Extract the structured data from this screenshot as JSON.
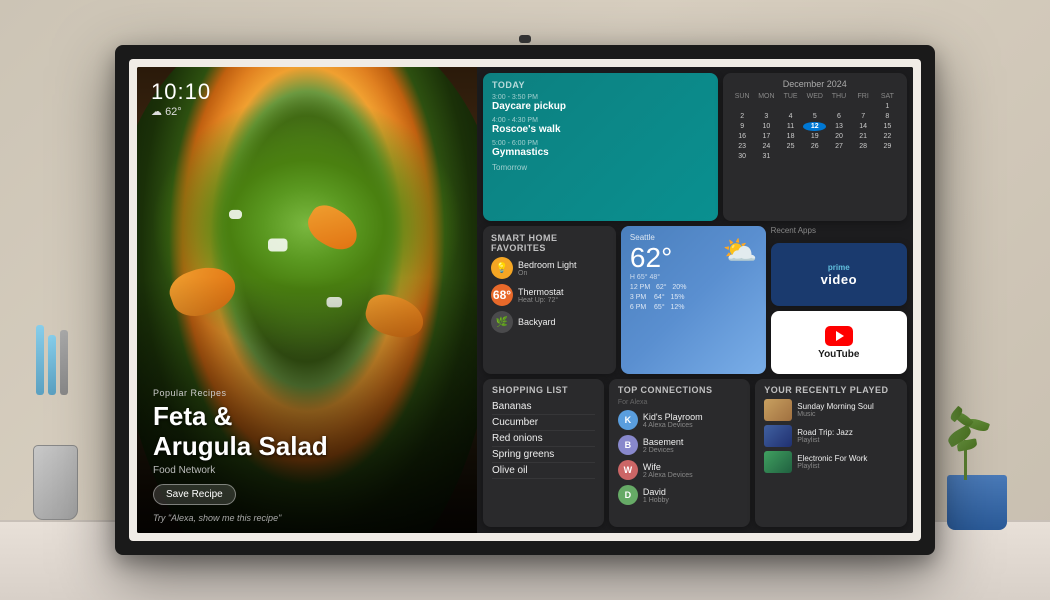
{
  "device": {
    "camera_label": "camera"
  },
  "recipe": {
    "label": "Popular Recipes",
    "title_line1": "Feta &",
    "title_line2": "Arugula Salad",
    "source": "Food Network",
    "save_button": "Save Recipe",
    "alexa_hint": "Try \"Alexa, show me this recipe\""
  },
  "clock": {
    "time": "10:10",
    "temp": "62°"
  },
  "today": {
    "section_title": "Today",
    "events": [
      {
        "time": "3:00 - 3:50 PM",
        "name": "Daycare pickup"
      },
      {
        "time": "4:00 - 4:30 PM",
        "name": "Roscoe's walk"
      },
      {
        "time": "5:00 - 6:00 PM",
        "name": "Gymnastics"
      }
    ],
    "tomorrow_label": "Tomorrow"
  },
  "calendar": {
    "month": "December 2024",
    "day_names": [
      "SUN",
      "MON",
      "TUE",
      "WED",
      "THU",
      "FRI",
      "SAT"
    ],
    "days": [
      {
        "d": "",
        "empty": true
      },
      {
        "d": "",
        "empty": true
      },
      {
        "d": "",
        "empty": true
      },
      {
        "d": "",
        "empty": true
      },
      {
        "d": "",
        "empty": true
      },
      {
        "d": "",
        "empty": true
      },
      {
        "d": "1"
      },
      {
        "d": "2"
      },
      {
        "d": "3"
      },
      {
        "d": "4"
      },
      {
        "d": "5"
      },
      {
        "d": "6"
      },
      {
        "d": "7"
      },
      {
        "d": "8"
      },
      {
        "d": "9"
      },
      {
        "d": "10"
      },
      {
        "d": "11"
      },
      {
        "d": "12",
        "today": true
      },
      {
        "d": "13"
      },
      {
        "d": "14"
      },
      {
        "d": "15"
      },
      {
        "d": "16"
      },
      {
        "d": "17"
      },
      {
        "d": "18"
      },
      {
        "d": "19"
      },
      {
        "d": "20"
      },
      {
        "d": "21"
      },
      {
        "d": "22"
      },
      {
        "d": "23"
      },
      {
        "d": "24"
      },
      {
        "d": "25"
      },
      {
        "d": "26"
      },
      {
        "d": "27"
      },
      {
        "d": "28"
      },
      {
        "d": "29"
      },
      {
        "d": "30"
      },
      {
        "d": "31"
      },
      {
        "d": "",
        "empty": true
      },
      {
        "d": "",
        "empty": true
      },
      {
        "d": "",
        "empty": true
      },
      {
        "d": "",
        "empty": true
      },
      {
        "d": "",
        "empty": true
      }
    ]
  },
  "smart_home": {
    "title": "Smart Home Favorites",
    "devices": [
      {
        "name": "Bedroom Light",
        "status": "On",
        "type": "light"
      },
      {
        "name": "Thermostat",
        "status": "Heat Up: 72°",
        "value": "68°",
        "type": "therm"
      },
      {
        "name": "Backyard",
        "status": "",
        "type": "backyard"
      }
    ]
  },
  "weather": {
    "location": "Seattle",
    "temp": "62°",
    "hi": "H 65° 48°",
    "rows": [
      {
        "label": "12 PM",
        "temp": "62°",
        "pct": "20%"
      },
      {
        "label": "3 PM",
        "temp": "64°",
        "pct": "15%"
      },
      {
        "label": "6 PM",
        "temp": "65°",
        "pct": "12%"
      }
    ]
  },
  "prime_video": {
    "label": "prime",
    "sub": "video"
  },
  "youtube": {
    "label": "YouTube"
  },
  "recent_apps": {
    "title": "Recent Apps"
  },
  "shopping_list": {
    "title": "Shopping List",
    "items": [
      "Bananas",
      "Cucumber",
      "Red onions",
      "Spring greens",
      "Olive oil"
    ]
  },
  "connections": {
    "title": "Top Connections",
    "subtitle": "For Alexa",
    "people": [
      {
        "name": "Kid's Playroom",
        "sub": "4 Alexa Devices",
        "color": "#5a9ede",
        "initial": "K"
      },
      {
        "name": "Basement",
        "sub": "2 Devices",
        "color": "#8888cc",
        "initial": "B"
      },
      {
        "name": "Wife",
        "sub": "2 Alexa Devices",
        "color": "#cc6666",
        "initial": "W"
      },
      {
        "name": "David",
        "sub": "1 Hobby",
        "color": "#66aa66",
        "initial": "D"
      }
    ]
  },
  "recently_played": {
    "title": "Your Recently Played",
    "tracks": [
      {
        "title": "Sunday Morning Soul",
        "sub": "Music",
        "thumb_class": "mt1"
      },
      {
        "title": "Road Trip: Jazz",
        "sub": "Playlist",
        "thumb_class": "mt2"
      },
      {
        "title": "Electronic For Work",
        "sub": "Playlist",
        "thumb_class": "mt3"
      }
    ]
  }
}
